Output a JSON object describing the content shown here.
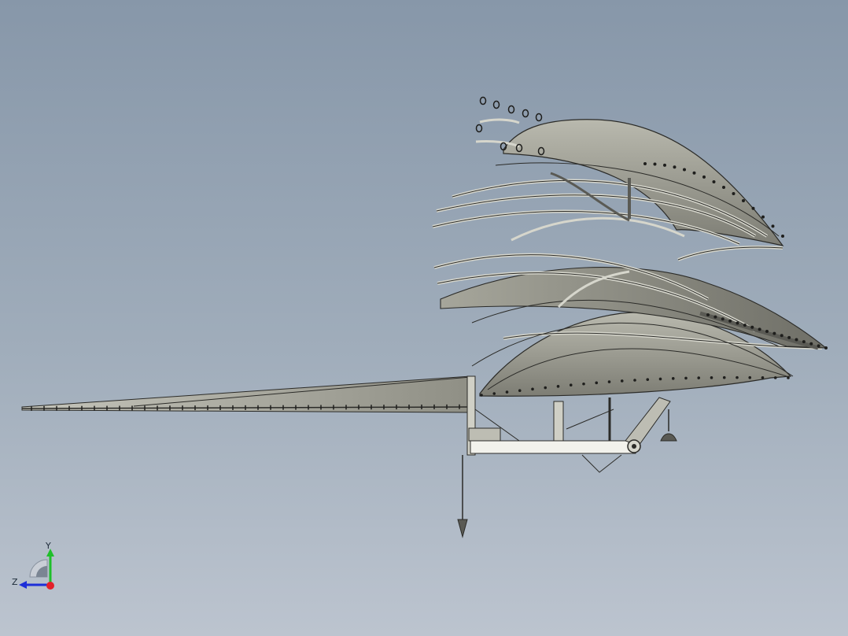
{
  "window": {
    "background_top": "#8797a9",
    "background_bottom": "#bcc4cf"
  },
  "model": {
    "membrane_color": "#8e8e84",
    "membrane_light": "#b9b9ae",
    "edge_color": "#2b2b28",
    "tube_color": "#d6d6cc"
  },
  "triad": {
    "y_label": "Y",
    "z_label": "Z",
    "y_color": "#1fbf2a",
    "z_color": "#1e2fd8",
    "x_color": "#e3202a"
  }
}
